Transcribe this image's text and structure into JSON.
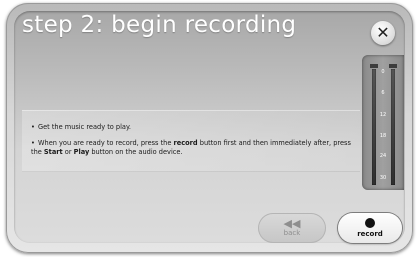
{
  "dialog": {
    "title": "step 2: begin recording",
    "close_symbol": "✕"
  },
  "instructions": {
    "bullet_1": "Get the music ready to play.",
    "bullet_2": {
      "text_a": "When you are ready to record, press the ",
      "bold_record": "record",
      "text_b": " button first and then immediately after, press the ",
      "bold_start": "Start",
      "text_c": " or ",
      "bold_play": "Play",
      "text_d": " button on the audio device."
    }
  },
  "level_meter": {
    "ticks": [
      "0",
      "6",
      "12",
      "18",
      "24",
      "30"
    ]
  },
  "buttons": {
    "back_label": "back",
    "back_icon": "rewind-icon",
    "back_glyph": "◀◀",
    "record_label": "record",
    "record_icon": "record-dot-icon"
  }
}
